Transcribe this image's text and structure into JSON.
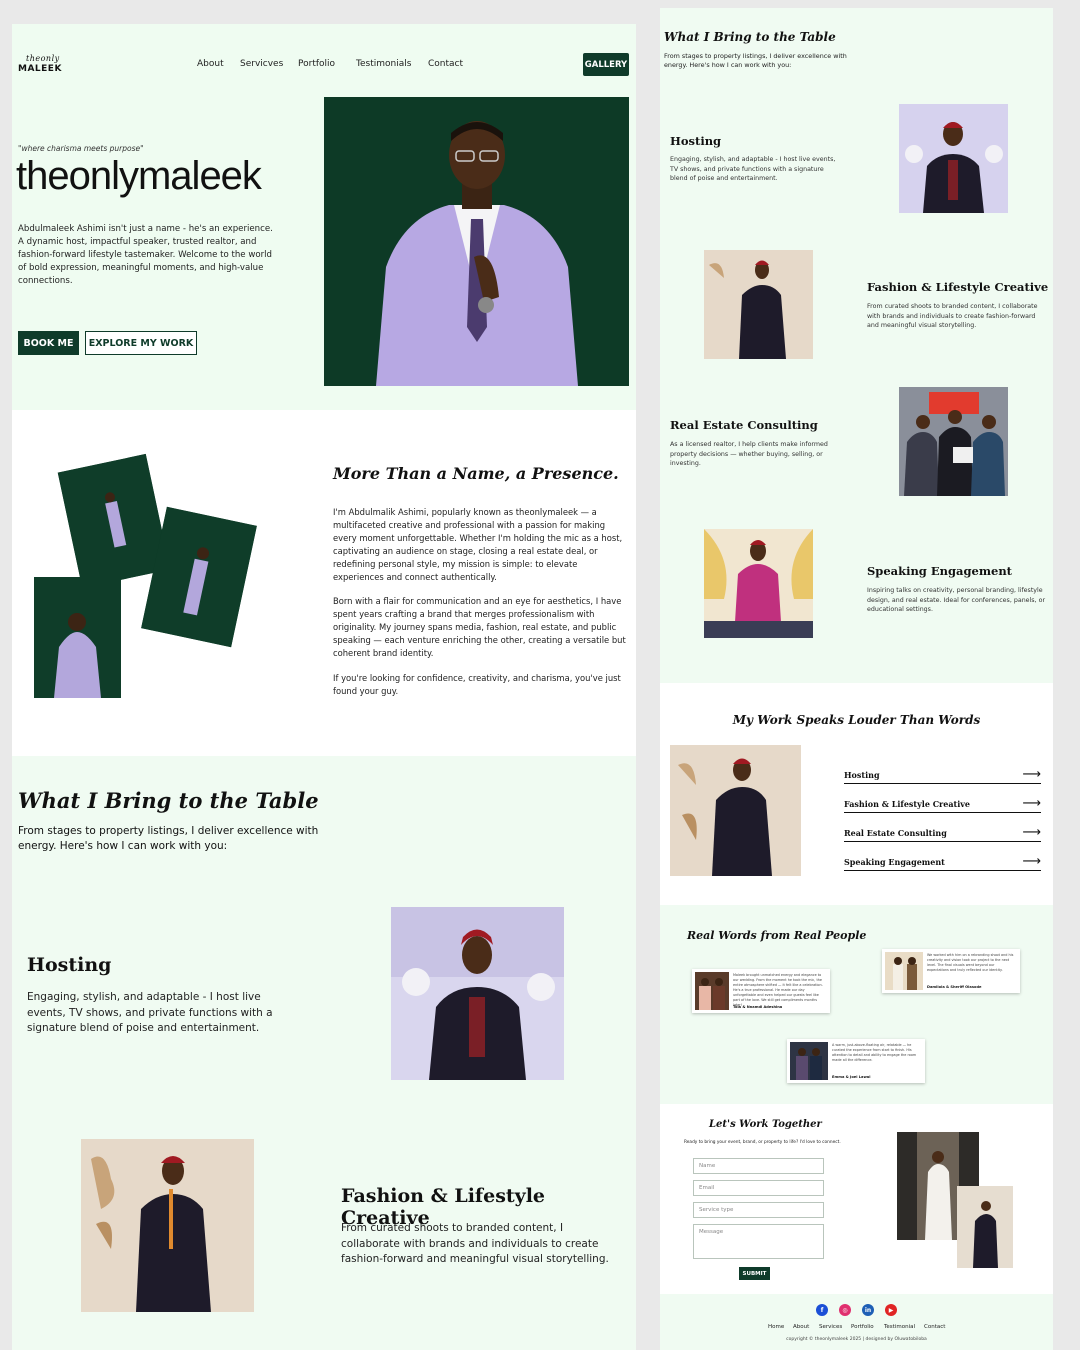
{
  "colors": {
    "brand_green": "#0f3b2a",
    "mint_bg": "#f0fbf2",
    "white": "#ffffff"
  },
  "header": {
    "logo_script": "theonly",
    "logo_text": "MALEEK",
    "nav": [
      "About",
      "Servicves",
      "Portfolio",
      "Testimonials",
      "Contact"
    ],
    "gallery_label": "GALLERY"
  },
  "hero": {
    "tagline": "\"where charisma meets purpose\"",
    "brand": "theonlymaleek",
    "description": "Abdulmaleek Ashimi isn't just a name - he's an experience. A dynamic host, impactful speaker, trusted realtor, and fashion-forward lifestyle tastemaker. Welcome to the world of bold expression, meaningful moments, and high-value connections.",
    "book_label": "BOOK ME",
    "explore_label": "EXPLORE MY WORK"
  },
  "about": {
    "title": "More Than a Name, a Presence.",
    "p1": "I'm Abdulmalik Ashimi, popularly known as theonlymaleek — a multifaceted creative and professional with a passion for making every moment unforgettable. Whether I'm holding the mic as a host, captivating an audience on stage, closing a real estate deal, or redefining personal style, my mission is simple: to elevate experiences and connect authentically.",
    "p2": "Born with a flair for communication and an eye for aesthetics, I have spent years crafting a brand that merges professionalism with originality. My journey spans media, fashion, real estate, and public speaking — each venture enriching the other, creating a versatile but coherent brand identity.",
    "p3": "If you're looking for confidence, creativity, and charisma, you've just found your guy."
  },
  "bring": {
    "title": "What I  Bring to the Table",
    "subtitle": "From stages to property listings, I deliver excellence with energy. Here's how I can work with you:"
  },
  "services": [
    {
      "title": "Hosting",
      "desc": "Engaging, stylish, and adaptable - I host live events, TV shows, and private functions with a signature blend of poise and entertainment."
    },
    {
      "title": "Fashion & Lifestyle Creative",
      "desc": "From curated shoots to branded content, I collaborate with brands and individuals to create fashion-forward and meaningful visual storytelling."
    },
    {
      "title": "Real Estate Consulting",
      "desc": "As a licensed realtor, I help clients make informed property decisions — whether buying, selling, or investing."
    },
    {
      "title": "Speaking Engagement",
      "desc": "Inspiring talks on creativity, personal branding, lifestyle design, and real estate. Ideal for conferences, panels, or educational settings."
    }
  ],
  "work": {
    "title": "My Work Speaks Louder Than Words",
    "items": [
      "Hosting",
      "Fashion & Lifestyle Creative",
      "Real Estate Consulting",
      "Speaking Engagement"
    ]
  },
  "testimonials": {
    "title": "Real Words from Real People",
    "cards": [
      {
        "quote": "Maleek brought unmatched energy and elegance to our wedding. From the moment he took the mic, the entire atmosphere shifted — it felt like a celebration. He's a true professional. He made our day unforgettable and even helped our guests feel like part of the love. We still get compliments months later!",
        "name": "Tola & Nnamdi Adeshina"
      },
      {
        "quote": "We worked with him on a rebranding shoot and his creativity and vision took our project to the next level. The final visuals went beyond our expectations and truly reflected our identity.",
        "name": "Damilola & Sheriff Olasode"
      },
      {
        "quote": "A warm, just-above-floating air, relatable — he curated the experience from start to finish. His attention to detail and ability to engage the room made all the difference.",
        "name": "Emma & Joel Lawal"
      }
    ]
  },
  "contact": {
    "title": "Let's Work Together",
    "subtitle": "Ready to bring your event, brand, or property to life? I'd love to connect.",
    "name_ph": "Name",
    "email_ph": "Email",
    "service_ph": "Service type",
    "message_ph": "Message",
    "submit_label": "SUBMIT"
  },
  "footer": {
    "social": [
      "facebook-icon",
      "instagram-icon",
      "linkedin-icon",
      "youtube-icon"
    ],
    "links": [
      "Home",
      "About",
      "Services",
      "Portfolio",
      "Testimonial",
      "Contact"
    ],
    "copyright": "copyright © theonlymaleek 2025 | designed by Oluwatobiloba"
  }
}
